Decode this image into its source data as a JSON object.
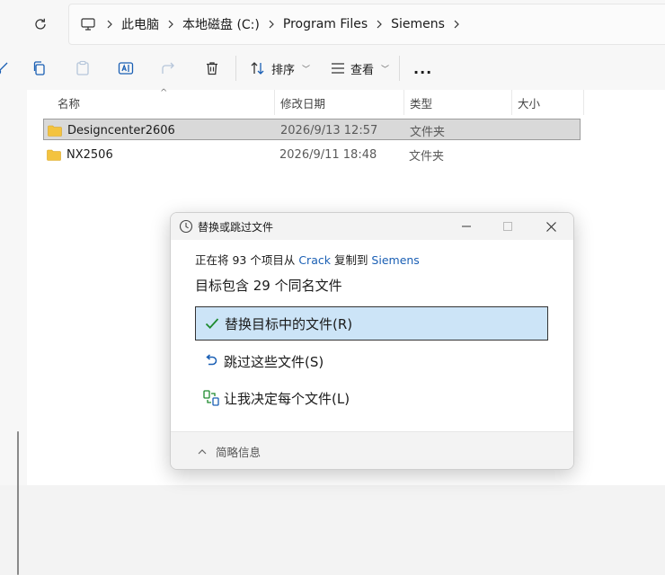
{
  "breadcrumb": {
    "items": [
      "此电脑",
      "本地磁盘 (C:)",
      "Program Files",
      "Siemens"
    ]
  },
  "toolbar": {
    "sort_label": "排序",
    "view_label": "查看",
    "more_label": "..."
  },
  "list": {
    "columns": [
      "名称",
      "修改日期",
      "类型",
      "大小"
    ],
    "rows": [
      {
        "name": "Designcenter2606",
        "date": "2026/9/13 12:57",
        "type": "文件夹",
        "size": "",
        "selected": true
      },
      {
        "name": "NX2506",
        "date": "2026/9/11 18:48",
        "type": "文件夹",
        "size": "",
        "selected": false
      }
    ]
  },
  "dialog": {
    "title": "替换或跳过文件",
    "sub_prefix": "正在将 93 个项目从 ",
    "source": "Crack",
    "sub_middle": " 复制到 ",
    "dest": "Siemens",
    "message": "目标包含 29 个同名文件",
    "options": {
      "replace": "替换目标中的文件(R)",
      "skip": "跳过这些文件(S)",
      "decide": "让我决定每个文件(L)"
    },
    "footer": "简略信息"
  },
  "colors": {
    "accent": "#1a5fb4",
    "option_selected_bg": "#cce4f7",
    "row_selected_bg": "#d9d9d9",
    "check_green": "#1e8a2e",
    "folder_yellow": "#f3c33f"
  }
}
